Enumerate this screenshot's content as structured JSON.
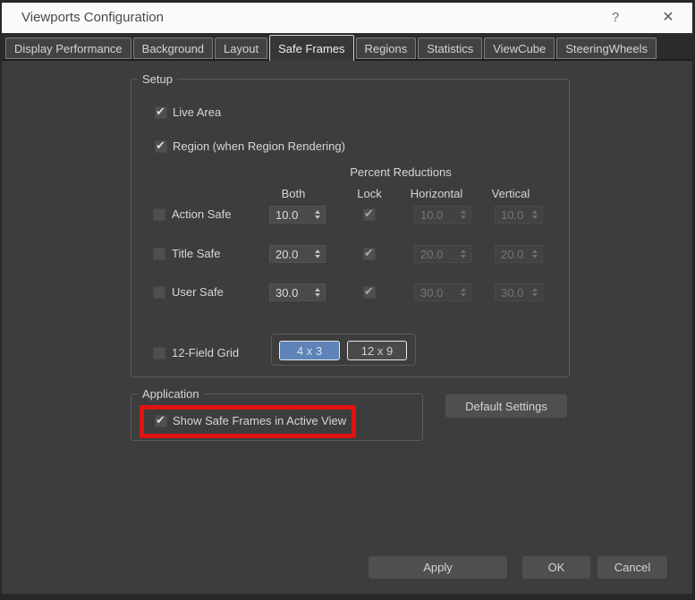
{
  "window": {
    "title": "Viewports Configuration",
    "help_icon": "?",
    "close_icon": "✕"
  },
  "tabs": [
    {
      "label": "Display Performance",
      "active": false
    },
    {
      "label": "Background",
      "active": false
    },
    {
      "label": "Layout",
      "active": false
    },
    {
      "label": "Safe Frames",
      "active": true
    },
    {
      "label": "Regions",
      "active": false
    },
    {
      "label": "Statistics",
      "active": false
    },
    {
      "label": "ViewCube",
      "active": false
    },
    {
      "label": "SteeringWheels",
      "active": false
    }
  ],
  "setup": {
    "group_label": "Setup",
    "live_area": {
      "label": "Live Area",
      "checked": true
    },
    "region": {
      "label": "Region (when Region Rendering)",
      "checked": true
    },
    "percent_reductions_label": "Percent Reductions",
    "columns": {
      "both": "Both",
      "lock": "Lock",
      "horizontal": "Horizontal",
      "vertical": "Vertical"
    },
    "rows": [
      {
        "label": "Action Safe",
        "checked": false,
        "both": "10.0",
        "lock": true,
        "horizontal": "10.0",
        "vertical": "10.0"
      },
      {
        "label": "Title Safe",
        "checked": false,
        "both": "20.0",
        "lock": true,
        "horizontal": "20.0",
        "vertical": "20.0"
      },
      {
        "label": "User Safe",
        "checked": false,
        "both": "30.0",
        "lock": true,
        "horizontal": "30.0",
        "vertical": "30.0"
      }
    ],
    "field_grid": {
      "label": "12-Field Grid",
      "checked": false,
      "buttons": [
        {
          "label": "4 x 3",
          "selected": true
        },
        {
          "label": "12 x 9",
          "selected": false
        }
      ]
    }
  },
  "application": {
    "group_label": "Application",
    "show_safe_frames": {
      "label": "Show Safe Frames in Active View",
      "checked": true
    }
  },
  "default_settings_label": "Default Settings",
  "footer": {
    "apply": "Apply",
    "ok": "OK",
    "cancel": "Cancel"
  },
  "colors": {
    "accent_blue": "#5d83b9",
    "highlight_red": "#e01212"
  }
}
